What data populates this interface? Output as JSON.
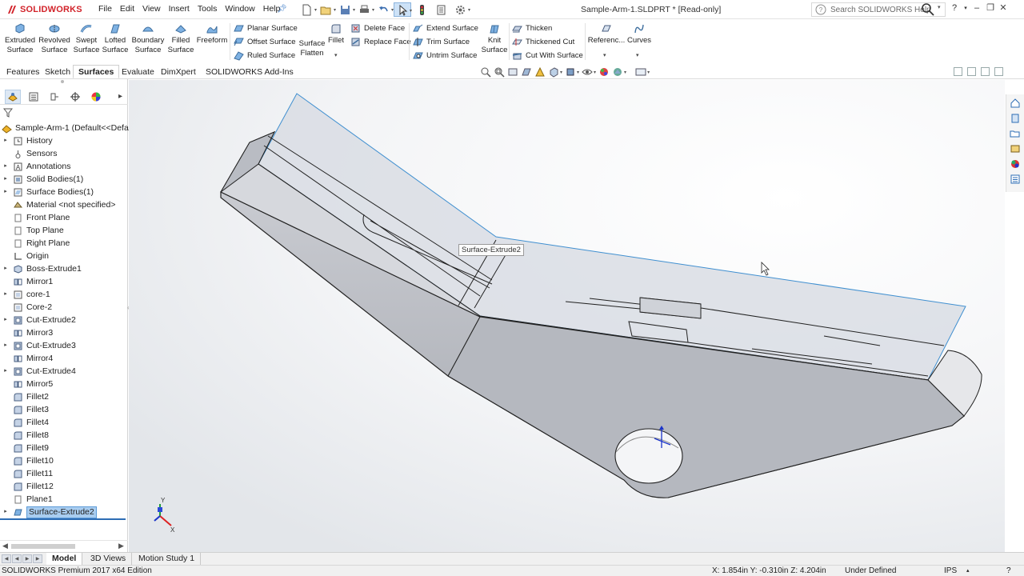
{
  "app": {
    "brand": "SOLIDWORKS",
    "document_title": "Sample-Arm-1.SLDPRT * [Read-only]"
  },
  "menu": [
    "File",
    "Edit",
    "View",
    "Insert",
    "Tools",
    "Window",
    "Help"
  ],
  "search": {
    "placeholder": "Search SOLIDWORKS Help"
  },
  "ribbon": {
    "big": [
      {
        "label": "Extruded\nSurface",
        "icon": "extruded-surface-icon"
      },
      {
        "label": "Revolved\nSurface",
        "icon": "revolved-surface-icon"
      },
      {
        "label": "Swept\nSurface",
        "icon": "swept-surface-icon"
      },
      {
        "label": "Lofted\nSurface",
        "icon": "lofted-surface-icon"
      },
      {
        "label": "Boundary\nSurface",
        "icon": "boundary-surface-icon"
      },
      {
        "label": "Filled\nSurface",
        "icon": "filled-surface-icon"
      },
      {
        "label": "Freeform",
        "icon": "freeform-icon"
      }
    ],
    "group1": [
      "Planar Surface",
      "Offset Surface",
      "Ruled Surface"
    ],
    "surface_flatten": "Surface\nFlatten",
    "fillet": "Fillet",
    "group2": [
      "Delete Face",
      "Replace Face"
    ],
    "group3": [
      "Extend Surface",
      "Trim Surface",
      "Untrim Surface"
    ],
    "knit_surface": "Knit\nSurface",
    "group4": [
      "Thicken",
      "Thickened Cut",
      "Cut With Surface"
    ],
    "reference": "Referenc...",
    "curves": "Curves"
  },
  "tabs": [
    "Features",
    "Sketch",
    "Surfaces",
    "Evaluate",
    "DimXpert",
    "SOLIDWORKS Add-Ins"
  ],
  "active_tab": "Surfaces",
  "tree": {
    "root": "Sample-Arm-1  (Default<<Defa",
    "items": [
      {
        "label": "History",
        "expandable": true,
        "icon": "history-icon"
      },
      {
        "label": "Sensors",
        "expandable": false,
        "icon": "sensor-icon"
      },
      {
        "label": "Annotations",
        "expandable": true,
        "icon": "annotations-icon"
      },
      {
        "label": "Solid Bodies(1)",
        "expandable": true,
        "icon": "solid-bodies-icon"
      },
      {
        "label": "Surface Bodies(1)",
        "expandable": true,
        "icon": "surface-bodies-icon"
      },
      {
        "label": "Material <not specified>",
        "expandable": false,
        "icon": "material-icon"
      },
      {
        "label": "Front Plane",
        "expandable": false,
        "icon": "plane-icon"
      },
      {
        "label": "Top Plane",
        "expandable": false,
        "icon": "plane-icon"
      },
      {
        "label": "Right Plane",
        "expandable": false,
        "icon": "plane-icon"
      },
      {
        "label": "Origin",
        "expandable": false,
        "icon": "origin-icon"
      },
      {
        "label": "Boss-Extrude1",
        "expandable": true,
        "icon": "boss-extrude-icon"
      },
      {
        "label": "Mirror1",
        "expandable": false,
        "icon": "mirror-icon"
      },
      {
        "label": "core-1",
        "expandable": true,
        "icon": "core-icon"
      },
      {
        "label": "Core-2",
        "expandable": false,
        "icon": "core-icon"
      },
      {
        "label": "Cut-Extrude2",
        "expandable": true,
        "icon": "cut-extrude-icon"
      },
      {
        "label": "Mirror3",
        "expandable": false,
        "icon": "mirror-icon"
      },
      {
        "label": "Cut-Extrude3",
        "expandable": true,
        "icon": "cut-extrude-icon"
      },
      {
        "label": "Mirror4",
        "expandable": false,
        "icon": "mirror-icon"
      },
      {
        "label": "Cut-Extrude4",
        "expandable": true,
        "icon": "cut-extrude-icon"
      },
      {
        "label": "Mirror5",
        "expandable": false,
        "icon": "mirror-icon"
      },
      {
        "label": "Fillet2",
        "expandable": false,
        "icon": "fillet-icon"
      },
      {
        "label": "Fillet3",
        "expandable": false,
        "icon": "fillet-icon"
      },
      {
        "label": "Fillet4",
        "expandable": false,
        "icon": "fillet-icon"
      },
      {
        "label": "Fillet8",
        "expandable": false,
        "icon": "fillet-icon"
      },
      {
        "label": "Fillet9",
        "expandable": false,
        "icon": "fillet-icon"
      },
      {
        "label": "Fillet10",
        "expandable": false,
        "icon": "fillet-icon"
      },
      {
        "label": "Fillet11",
        "expandable": false,
        "icon": "fillet-icon"
      },
      {
        "label": "Fillet12",
        "expandable": false,
        "icon": "fillet-icon"
      },
      {
        "label": "Plane1",
        "expandable": false,
        "icon": "plane-icon"
      },
      {
        "label": "Surface-Extrude2",
        "expandable": true,
        "icon": "surface-extrude-icon",
        "selected": true
      }
    ]
  },
  "viewport": {
    "tooltip": "Surface-Extrude2",
    "triad_labels": [
      "Y",
      "X"
    ]
  },
  "bottom_tabs": [
    "Model",
    "3D Views",
    "Motion Study 1"
  ],
  "active_bottom_tab": "Model",
  "status": {
    "edition": "SOLIDWORKS Premium 2017 x64 Edition",
    "coords": "X: 1.854in Y: -0.310in Z: 4.204in",
    "state": "Under Defined",
    "units": "IPS"
  },
  "colors": {
    "accent": "#2d6db5",
    "brand_red": "#d2232a",
    "selection": "#a9cdf0",
    "surface_edge": "#3f8fd0"
  }
}
